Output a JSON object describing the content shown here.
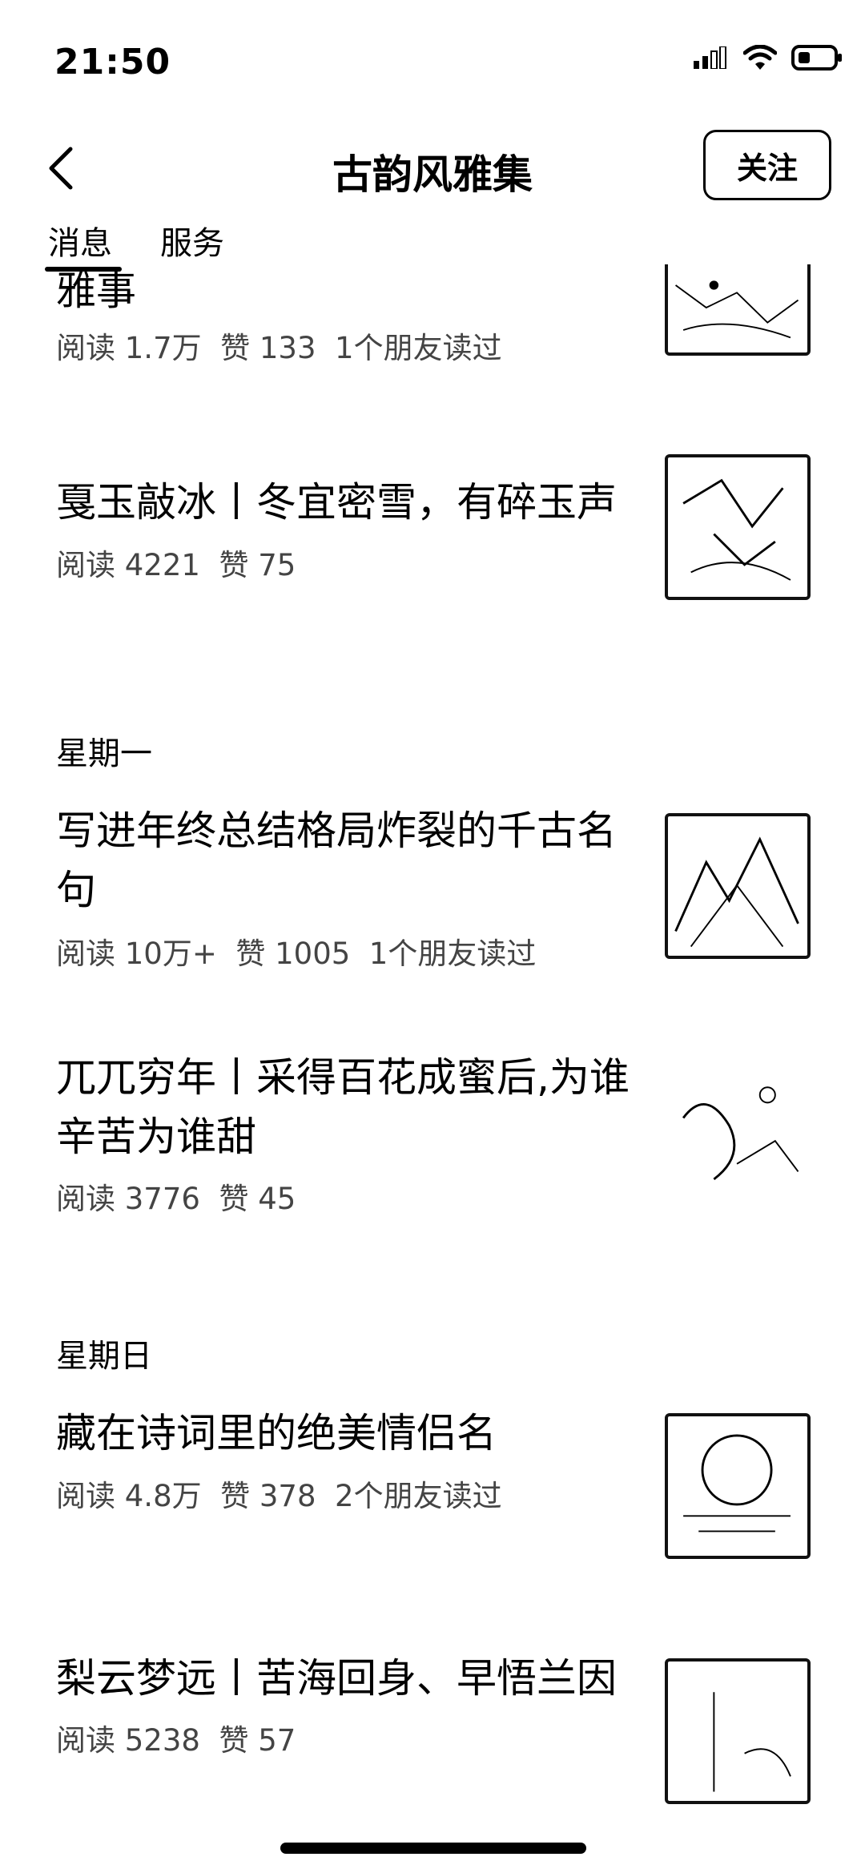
{
  "status": {
    "time": "21:50"
  },
  "nav": {
    "title": "古韵风雅集",
    "follow_label": "关注"
  },
  "tabs": [
    {
      "label": "消息"
    },
    {
      "label": "服务"
    }
  ],
  "articles": [
    {
      "title": "雅事",
      "meta": "阅读 1.7万  赞 133  1个朋友读过"
    },
    {
      "title": "戛玉敲冰丨冬宜密雪，有碎玉声",
      "meta": "阅读 4221  赞 75"
    },
    {
      "title": "写进年终总结格局炸裂的千古名句",
      "meta": "阅读 10万+  赞 1005  1个朋友读过"
    },
    {
      "title": "兀兀穷年丨采得百花成蜜后,为谁辛苦为谁甜",
      "meta": "阅读 3776  赞 45"
    },
    {
      "title": "藏在诗词里的绝美情侣名",
      "meta": "阅读 4.8万  赞 378  2个朋友读过"
    },
    {
      "title": "梨云梦远丨苦海回身、早悟兰因",
      "meta": "阅读 5238  赞 57"
    }
  ],
  "dates": [
    {
      "label": "星期一"
    },
    {
      "label": "星期日"
    }
  ]
}
